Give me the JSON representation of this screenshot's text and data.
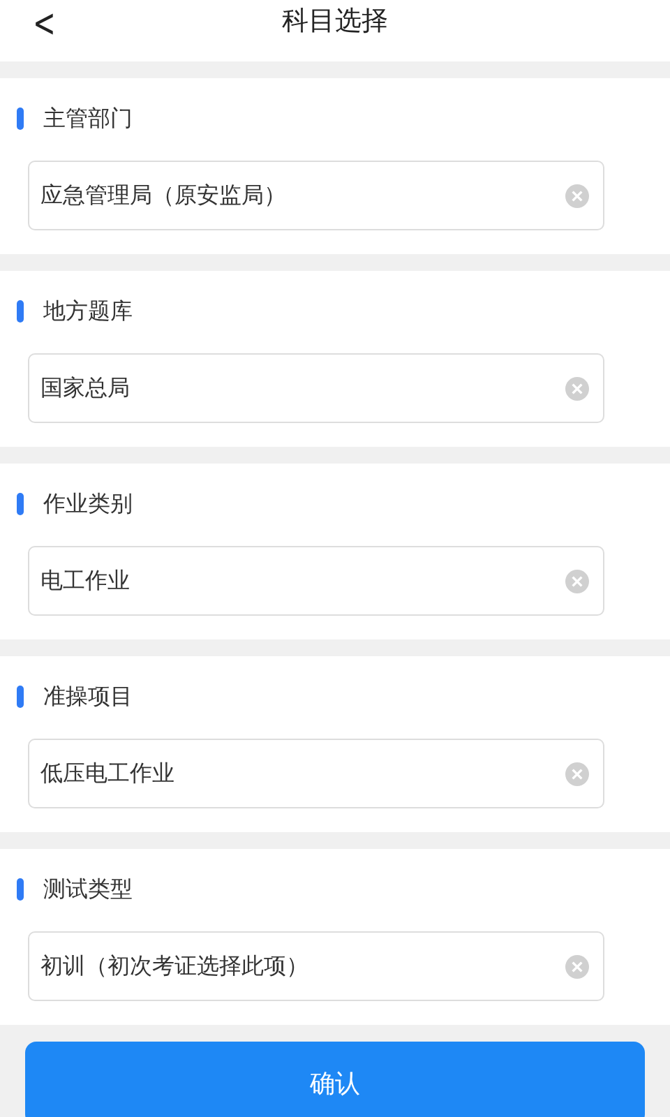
{
  "header": {
    "back": "<",
    "title": "科目选择"
  },
  "sections": [
    {
      "label": "主管部门",
      "value": "应急管理局（原安监局）"
    },
    {
      "label": "地方题库",
      "value": "国家总局"
    },
    {
      "label": "作业类别",
      "value": "电工作业"
    },
    {
      "label": "准操项目",
      "value": "低压电工作业"
    },
    {
      "label": "测试类型",
      "value": "初训（初次考证选择此项）"
    }
  ],
  "confirm_button": "确认"
}
